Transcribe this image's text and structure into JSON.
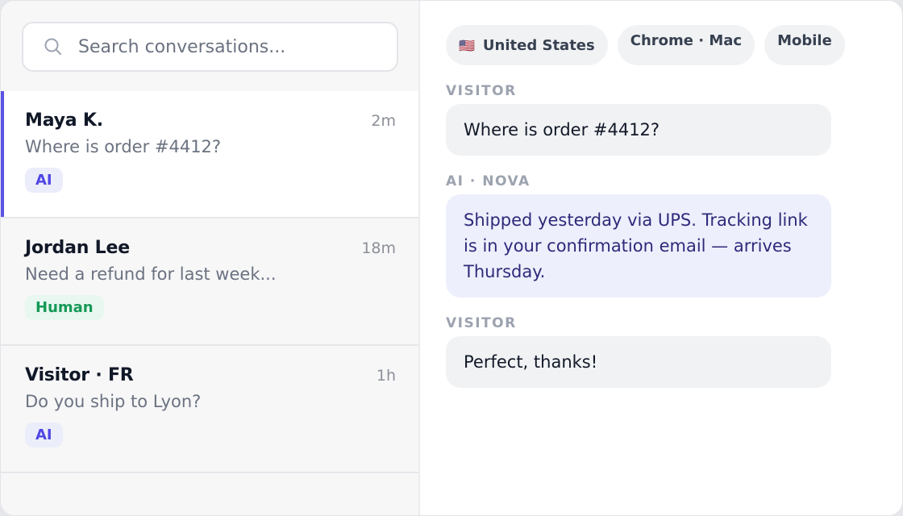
{
  "search": {
    "placeholder": "Search conversations..."
  },
  "conversations": [
    {
      "name": "Maya K.",
      "time": "2m",
      "preview": "Where is order #4412?",
      "badge": "AI"
    },
    {
      "name": "Jordan Lee",
      "time": "18m",
      "preview": "Need a refund for last week...",
      "badge": "Human"
    },
    {
      "name": "Visitor · FR",
      "time": "1h",
      "preview": "Do you ship to Lyon?",
      "badge": "AI"
    }
  ],
  "visitor_info": {
    "flag": "🇺🇸",
    "country": "United States",
    "browser": "Chrome · Mac",
    "device": "Mobile"
  },
  "messages": [
    {
      "sender": "VISITOR",
      "text": "Where is order #4412?"
    },
    {
      "sender": "AI · NOVA",
      "text": "Shipped yesterday via UPS. Tracking link is in your confirmation email — arrives Thursday."
    },
    {
      "sender": "VISITOR",
      "text": "Perfect, thanks!"
    }
  ],
  "colors": {
    "accent": "#5b52e6",
    "ai_badge": "#4f46e5",
    "human_badge": "#159957",
    "ai_bubble": "#edeffc"
  }
}
